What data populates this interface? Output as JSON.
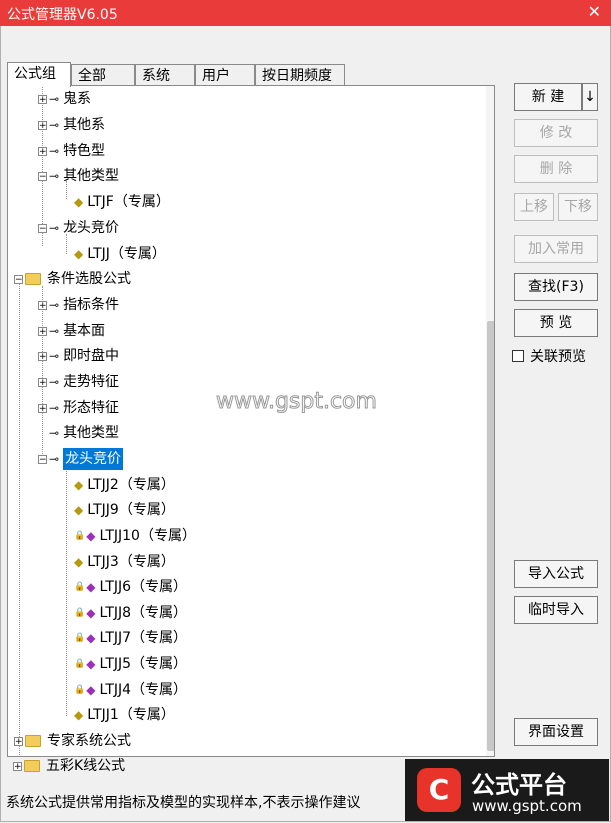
{
  "window": {
    "title": "公式管理器V6.05",
    "close": "✕"
  },
  "tabs": [
    "公式组",
    "全部",
    "系统",
    "用户",
    "按日期频度"
  ],
  "tree": {
    "n1": "鬼系",
    "n2": "其他系",
    "n3": "特色型",
    "n4": "其他类型",
    "n5": "LTJF（专属）",
    "n6": "龙头竞价",
    "n7": "LTJJ（专属）",
    "n8": "条件选股公式",
    "n9": "指标条件",
    "n10": "基本面",
    "n11": "即时盘中",
    "n12": "走势特征",
    "n13": "形态特征",
    "n14": "其他类型",
    "n15": "龙头竞价",
    "n16": "LTJJ2（专属）",
    "n17": "LTJJ9（专属）",
    "n18": "LTJJ10（专属）",
    "n19": "LTJJ3（专属）",
    "n20": "LTJJ6（专属）",
    "n21": "LTJJ8（专属）",
    "n22": "LTJJ7（专属）",
    "n23": "LTJJ5（专属）",
    "n24": "LTJJ4（专属）",
    "n25": "LTJJ1（专属）",
    "n26": "专家系统公式",
    "n27": "五彩K线公式"
  },
  "buttons": {
    "new": "新 建",
    "new_arrow": "↓",
    "edit": "修 改",
    "delete": "删 除",
    "move_up": "上移",
    "move_down": "下移",
    "add_common": "加入常用",
    "find": "查找(F3)",
    "preview": "预 览",
    "linked_preview": "关联预览",
    "import": "导入公式",
    "temp_import": "临时导入",
    "ui_settings": "界面设置"
  },
  "status_text": "系统公式提供常用指标及模型的实现样本,不表示操作建议",
  "watermark": "www.gspt.com",
  "logo": {
    "line1": "公式平台",
    "line2": "www.gspt.com",
    "mark": "C"
  },
  "colors": {
    "titlebar": "#ea3b3b",
    "selection": "#0078d7"
  }
}
